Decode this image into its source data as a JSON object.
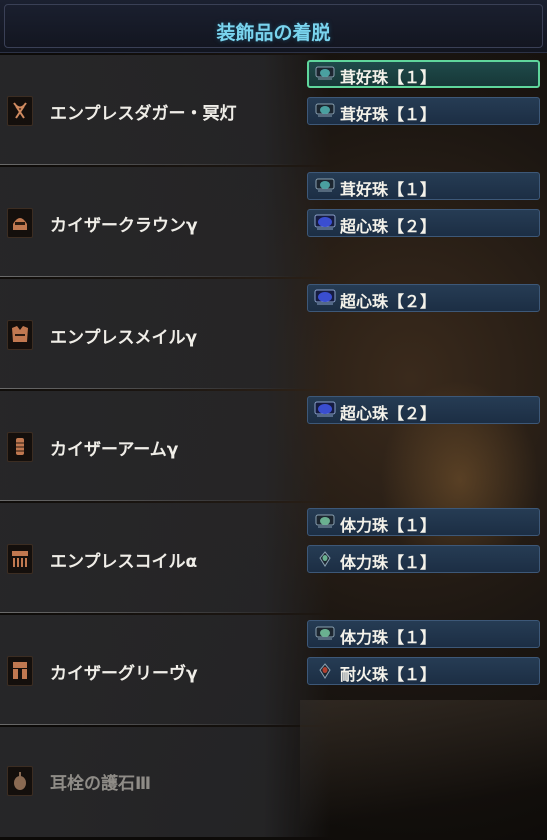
{
  "screen": {
    "title": "装飾品の着脱"
  },
  "colors": {
    "title": "#7ad4ee",
    "slot_blue": "#263c54",
    "slot_green_border": "#5fd69c",
    "gem_small": "#4aa0a0",
    "gem_medium": "#3a4ed0",
    "gem_red": "#b04030",
    "gem_green": "#6ab090"
  },
  "equipment": [
    {
      "name": "エンプレスダガー・冥灯",
      "icon": "weapon-dagger-icon",
      "decorations": [
        {
          "label": "茸好珠【１】",
          "gem": "small-teal",
          "selected": true
        },
        {
          "label": "茸好珠【１】",
          "gem": "small-teal",
          "selected": false
        }
      ]
    },
    {
      "name": "カイザークラウンγ",
      "icon": "helm-icon",
      "decorations": [
        {
          "label": "茸好珠【１】",
          "gem": "small-teal",
          "selected": false
        },
        {
          "label": "超心珠【２】",
          "gem": "medium-blue",
          "selected": false
        }
      ]
    },
    {
      "name": "エンプレスメイルγ",
      "icon": "chest-icon",
      "decorations": [
        {
          "label": "超心珠【２】",
          "gem": "medium-blue",
          "selected": false
        }
      ]
    },
    {
      "name": "カイザーアームγ",
      "icon": "arm-icon",
      "decorations": [
        {
          "label": "超心珠【２】",
          "gem": "medium-blue",
          "selected": false
        }
      ]
    },
    {
      "name": "エンプレスコイルα",
      "icon": "waist-icon",
      "decorations": [
        {
          "label": "体力珠【１】",
          "gem": "small-teal",
          "selected": false
        },
        {
          "label": "体力珠【１】",
          "gem": "small-green",
          "selected": false
        }
      ]
    },
    {
      "name": "カイザーグリーヴγ",
      "icon": "legs-icon",
      "decorations": [
        {
          "label": "体力珠【１】",
          "gem": "small-teal",
          "selected": false
        },
        {
          "label": "耐火珠【１】",
          "gem": "small-red",
          "selected": false
        }
      ]
    },
    {
      "name": "耳栓の護石Ⅲ",
      "icon": "charm-icon",
      "dim": true,
      "decorations": []
    }
  ]
}
